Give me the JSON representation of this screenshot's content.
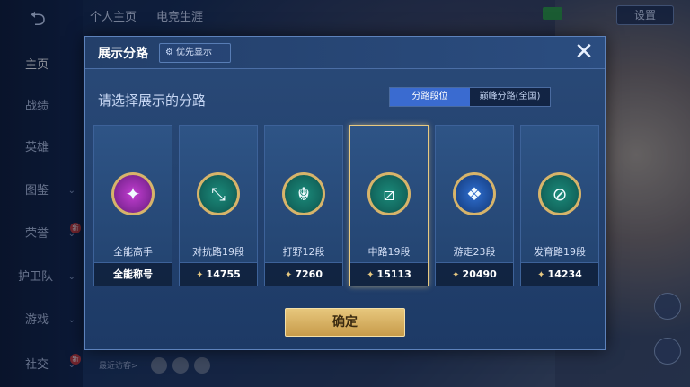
{
  "background": {
    "sidebar": {
      "items": [
        {
          "label": "主页"
        },
        {
          "label": "战绩"
        },
        {
          "label": "英雄"
        },
        {
          "label": "图鉴"
        },
        {
          "label": "荣誉"
        },
        {
          "label": "护卫队"
        },
        {
          "label": "游戏"
        },
        {
          "label": "社交"
        }
      ]
    },
    "top_tabs": [
      "个人主页",
      "电竞生涯"
    ],
    "settings_label": "设置",
    "visitors_label": "最近访客>"
  },
  "dialog": {
    "title": "展示分路",
    "priority_label": "优先显示",
    "close_icon": "close-icon",
    "subtitle": "请选择展示的分路",
    "segments": [
      {
        "label": "分路段位",
        "active": true
      },
      {
        "label": "巅峰分路(全国)",
        "active": false
      }
    ],
    "cards": [
      {
        "label": "全能高手",
        "value": "全能称号",
        "icon": "all-round-emblem",
        "selected": false
      },
      {
        "label": "对抗路19段",
        "value": "14755",
        "icon": "clash-lane-emblem",
        "selected": false
      },
      {
        "label": "打野12段",
        "value": "7260",
        "icon": "jungle-emblem",
        "selected": false
      },
      {
        "label": "中路19段",
        "value": "15113",
        "icon": "mid-lane-emblem",
        "selected": true
      },
      {
        "label": "游走23段",
        "value": "20490",
        "icon": "roam-emblem",
        "selected": false
      },
      {
        "label": "发育路19段",
        "value": "14234",
        "icon": "farm-lane-emblem",
        "selected": false
      }
    ],
    "confirm_label": "确定"
  },
  "colors": {
    "accent_gold": "#e7c981",
    "segment_active": "#3a6bd0",
    "dialog_bg": "#1d3a66"
  }
}
